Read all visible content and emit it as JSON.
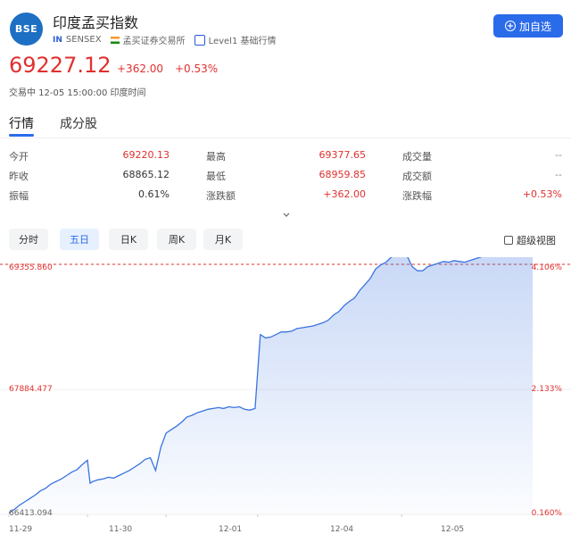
{
  "header": {
    "logo_text": "BSE",
    "title": "印度孟买指数",
    "market_badge": "IN",
    "code": "SENSEX",
    "exchange": "孟买证券交易所",
    "level": "Level1 基础行情",
    "add_button": "加自选"
  },
  "quote": {
    "price": "69227.12",
    "change": "+362.00",
    "change_pct": "+0.53%",
    "status": "交易中 12-05 15:00:00 印度时间"
  },
  "tabs": [
    {
      "label": "行情",
      "active": true
    },
    {
      "label": "成分股",
      "active": false
    }
  ],
  "stats": [
    [
      {
        "label": "今开",
        "value": "69220.13"
      },
      {
        "label": "最高",
        "value": "69377.65"
      },
      {
        "label": "成交量",
        "value": "--"
      }
    ],
    [
      {
        "label": "昨收",
        "value": "68865.12"
      },
      {
        "label": "最低",
        "value": "68959.85"
      },
      {
        "label": "成交额",
        "value": "--"
      }
    ],
    [
      {
        "label": "振幅",
        "value": "0.61%"
      },
      {
        "label": "涨跌额",
        "value": "+362.00"
      },
      {
        "label": "涨跌幅",
        "value": "+0.53%"
      }
    ]
  ],
  "kline_tabs": [
    {
      "label": "分时",
      "active": false
    },
    {
      "label": "五日",
      "active": true
    },
    {
      "label": "日K",
      "active": false
    },
    {
      "label": "周K",
      "active": false
    },
    {
      "label": "月K",
      "active": false
    }
  ],
  "super_chart": "超级视图",
  "colors": {
    "up": "#e0302f",
    "accent": "#2a6bea",
    "line": "#3a73e0"
  },
  "chart_data": {
    "type": "area",
    "y_left_labels": [
      "69355.860",
      "67884.477",
      "66413.094"
    ],
    "y_right_labels": [
      "4.106%",
      "2.133%",
      "0.160%"
    ],
    "x_labels": [
      "11-29",
      "11-30",
      "12-01",
      "12-04",
      "12-05"
    ],
    "ylim": [
      66413.094,
      69355.86
    ],
    "reference_line": 69355.86,
    "series": [
      {
        "x": [
          0,
          2,
          4,
          6,
          8,
          10,
          12,
          14,
          16,
          18,
          20,
          22,
          24,
          26,
          28,
          30,
          31,
          32,
          34,
          36,
          38,
          40,
          42,
          44,
          46,
          48,
          50,
          52,
          54,
          56,
          58,
          60,
          62,
          64,
          66,
          68,
          70,
          72,
          74,
          76,
          78,
          80,
          82,
          84,
          86,
          88,
          90,
          92,
          94,
          96,
          98,
          100,
          102,
          104,
          106,
          108,
          110,
          112,
          114,
          116,
          118,
          120,
          122,
          124,
          126,
          128,
          130,
          132,
          134,
          136,
          138,
          140,
          142,
          144,
          146,
          148,
          150,
          152,
          154,
          156,
          158,
          160,
          162,
          164,
          166,
          168,
          170,
          172,
          174,
          176,
          178,
          180,
          182,
          184,
          186,
          188,
          190,
          192,
          194,
          196,
          198,
          200
        ],
        "values": [
          66430,
          66470,
          66520,
          66560,
          66600,
          66640,
          66690,
          66720,
          66770,
          66800,
          66830,
          66870,
          66910,
          66940,
          67000,
          67050,
          66780,
          66800,
          66820,
          66830,
          66850,
          66840,
          66870,
          66900,
          66930,
          66970,
          67010,
          67060,
          67080,
          66930,
          67200,
          67370,
          67410,
          67450,
          67500,
          67560,
          67580,
          67610,
          67630,
          67650,
          67660,
          67670,
          67660,
          67680,
          67670,
          67680,
          67650,
          67640,
          67660,
          68530,
          68490,
          68500,
          68530,
          68560,
          68560,
          68570,
          68600,
          68610,
          68620,
          68630,
          68650,
          68670,
          68700,
          68760,
          68800,
          68870,
          68920,
          68960,
          69050,
          69120,
          69190,
          69300,
          69350,
          69380,
          69440,
          69470,
          69480,
          69460,
          69330,
          69280,
          69280,
          69330,
          69350,
          69370,
          69390,
          69380,
          69400,
          69390,
          69380,
          69400,
          69420,
          69440,
          69460,
          69480,
          69470,
          69460,
          69450,
          69470,
          69480,
          69490,
          69500,
          69510
        ]
      }
    ]
  }
}
